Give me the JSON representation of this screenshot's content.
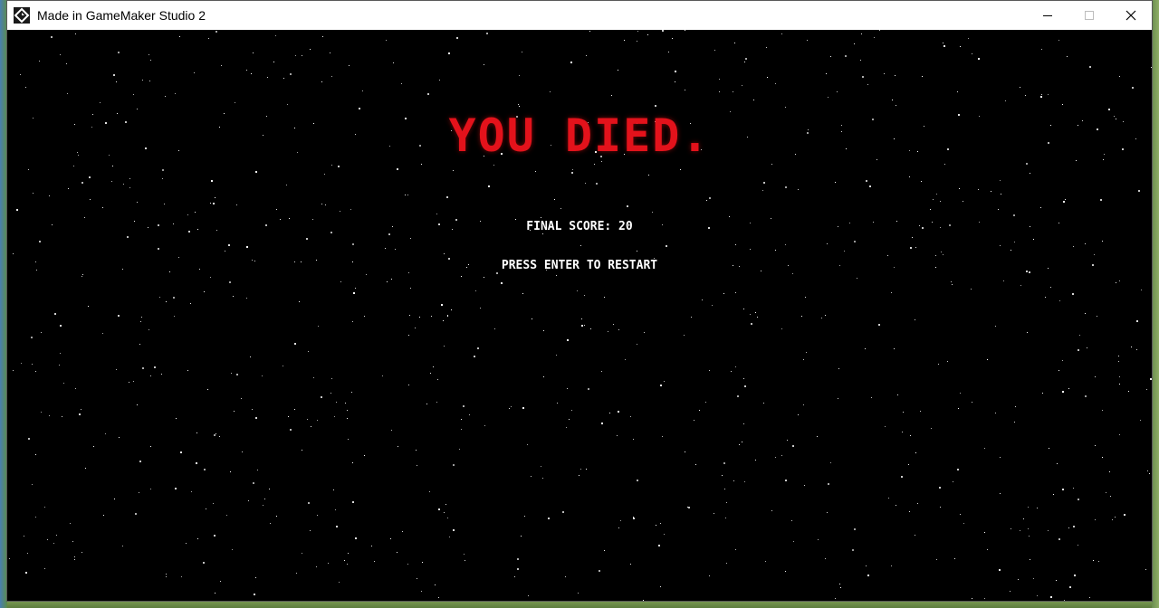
{
  "window": {
    "title": "Made in GameMaker Studio 2",
    "app_icon": "gamemaker-logo-icon",
    "controls": {
      "minimize_icon": "minimize-icon",
      "maximize_icon": "maximize-icon",
      "close_icon": "close-icon"
    }
  },
  "game": {
    "death_message": "YOU DIED.",
    "score_label": "FINAL SCORE:",
    "score_value": "20",
    "restart_prompt": "PRESS ENTER TO RESTART",
    "background": "starfield",
    "colors": {
      "death_message": "#e3121b",
      "text": "#ffffff",
      "background": "#000000"
    }
  }
}
